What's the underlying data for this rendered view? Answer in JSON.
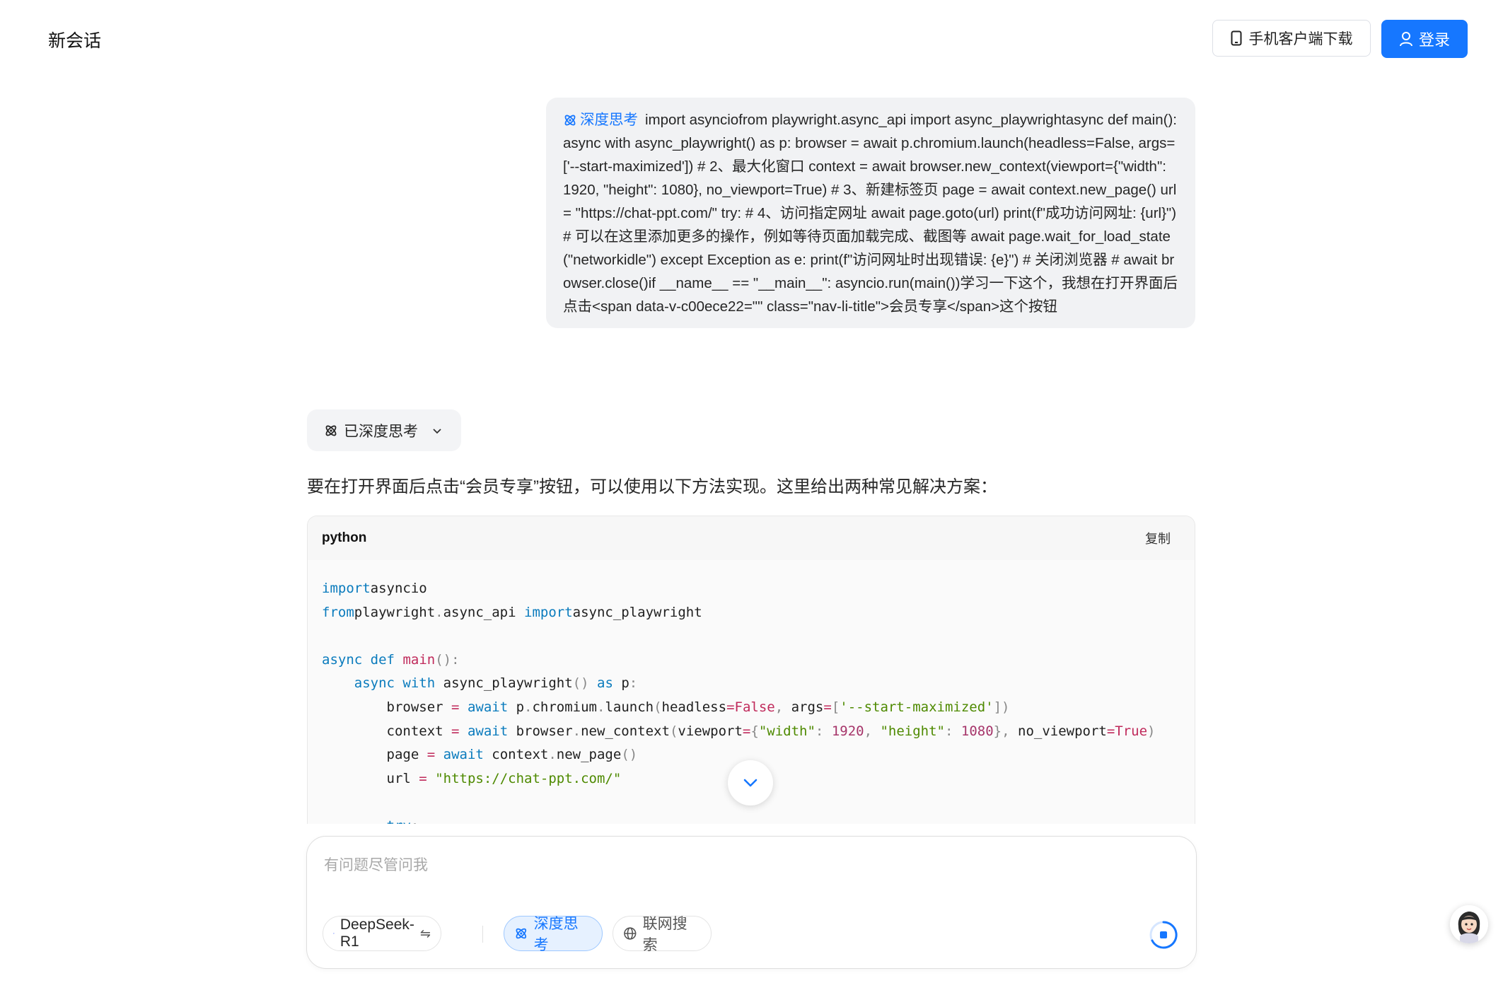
{
  "header": {
    "title": "新会话",
    "download_label": "手机客户端下载",
    "login_label": "登录"
  },
  "user_message": {
    "tag": "深度思考",
    "text": "import asynciofrom playwright.async_api import async_playwrightasync def main(): async with async_playwright() as p: browser = await p.chromium.launch(headless=False, args=['--start-maximized']) # 2、最大化窗口 context = await browser.new_context(viewport={\"width\": 1920, \"height\": 1080}, no_viewport=True) # 3、新建标签页 page = await context.new_page() url = \"https://chat-ppt.com/\" try: # 4、访问指定网址 await page.goto(url) print(f\"成功访问网址: {url}\") # 可以在这里添加更多的操作，例如等待页面加载完成、截图等 await page.wait_for_load_state(\"networkidle\") except Exception as e: print(f\"访问网址时出现错误: {e}\") # 关闭浏览器 # await browser.close()if __name__ == \"__main__\": asyncio.run(main())学习一下这个，我想在打开界面后点击<span data-v-c00ece22=\"\" class=\"nav-li-title\">会员专享</span>这个按钮"
  },
  "assistant": {
    "think_label": "已深度思考",
    "intro": "要在打开界面后点击“会员专享”按钮，可以使用以下方法实现。这里给出两种常见解决方案：",
    "code_block": {
      "language": "python",
      "copy_label": "复制",
      "lines": [
        [
          [
            "kw",
            "import"
          ],
          [
            "",
            "asyncio"
          ]
        ],
        [
          [
            "kw",
            "from"
          ],
          [
            "",
            "playwright"
          ],
          [
            "pun",
            "."
          ],
          [
            "",
            "async_api "
          ],
          [
            "kw",
            "import"
          ],
          [
            "",
            "async_playwright"
          ]
        ],
        [],
        [
          [
            "kw",
            "async"
          ],
          [
            "",
            " "
          ],
          [
            "kw",
            "def"
          ],
          [
            "",
            " "
          ],
          [
            "fn",
            "main"
          ],
          [
            "pun",
            "():"
          ]
        ],
        [
          [
            "",
            "    "
          ],
          [
            "kw",
            "async"
          ],
          [
            "",
            " "
          ],
          [
            "kw",
            "with"
          ],
          [
            "",
            " async_playwright"
          ],
          [
            "pun",
            "()"
          ],
          [
            "",
            " "
          ],
          [
            "kw",
            "as"
          ],
          [
            "",
            " p"
          ],
          [
            "pun",
            ":"
          ]
        ],
        [
          [
            "",
            "        browser "
          ],
          [
            "fn",
            "="
          ],
          [
            "",
            " "
          ],
          [
            "kw",
            "await"
          ],
          [
            "",
            " p"
          ],
          [
            "pun",
            "."
          ],
          [
            "",
            "chromium"
          ],
          [
            "pun",
            "."
          ],
          [
            "",
            "launch"
          ],
          [
            "pun",
            "("
          ],
          [
            "",
            "headless"
          ],
          [
            "fn",
            "=False"
          ],
          [
            "pun",
            ","
          ],
          [
            "",
            " args"
          ],
          [
            "fn",
            "="
          ],
          [
            "pun",
            "["
          ],
          [
            "str",
            "'--start-maximized'"
          ],
          [
            "pun",
            "])"
          ]
        ],
        [
          [
            "",
            "        context "
          ],
          [
            "fn",
            "="
          ],
          [
            "",
            " "
          ],
          [
            "kw",
            "await"
          ],
          [
            "",
            " browser"
          ],
          [
            "pun",
            "."
          ],
          [
            "",
            "new_context"
          ],
          [
            "pun",
            "("
          ],
          [
            "",
            "viewport"
          ],
          [
            "fn",
            "="
          ],
          [
            "pun",
            "{"
          ],
          [
            "str",
            "\"width\""
          ],
          [
            "pun",
            ":"
          ],
          [
            "",
            " "
          ],
          [
            "num",
            "1920"
          ],
          [
            "pun",
            ","
          ],
          [
            "",
            " "
          ],
          [
            "str",
            "\"height\""
          ],
          [
            "pun",
            ":"
          ],
          [
            "",
            " "
          ],
          [
            "num",
            "1080"
          ],
          [
            "pun",
            "},"
          ],
          [
            "",
            " no_viewport"
          ],
          [
            "fn",
            "=True"
          ],
          [
            "pun",
            ")"
          ]
        ],
        [
          [
            "",
            "        page "
          ],
          [
            "fn",
            "="
          ],
          [
            "",
            " "
          ],
          [
            "kw",
            "await"
          ],
          [
            "",
            " context"
          ],
          [
            "pun",
            "."
          ],
          [
            "",
            "new_page"
          ],
          [
            "pun",
            "()"
          ]
        ],
        [
          [
            "",
            "        url "
          ],
          [
            "fn",
            "="
          ],
          [
            "",
            " "
          ],
          [
            "str",
            "\"https://chat-ppt.com/\""
          ]
        ],
        [],
        [
          [
            "",
            "        "
          ],
          [
            "kw",
            "try"
          ],
          [
            "pun",
            ":"
          ]
        ]
      ]
    }
  },
  "composer": {
    "placeholder": "有问题尽管问我",
    "model_label": "DeepSeek-R1",
    "model_switch_glyph": "⇋",
    "deep_think_label": "深度思考",
    "web_search_label": "联网搜索"
  },
  "colors": {
    "primary": "#1677ff",
    "bubble_bg": "#f1f2f4",
    "keyword": "#0a7bbd",
    "function": "#c02a5b",
    "string": "#4e8a00",
    "number": "#a6356a"
  }
}
